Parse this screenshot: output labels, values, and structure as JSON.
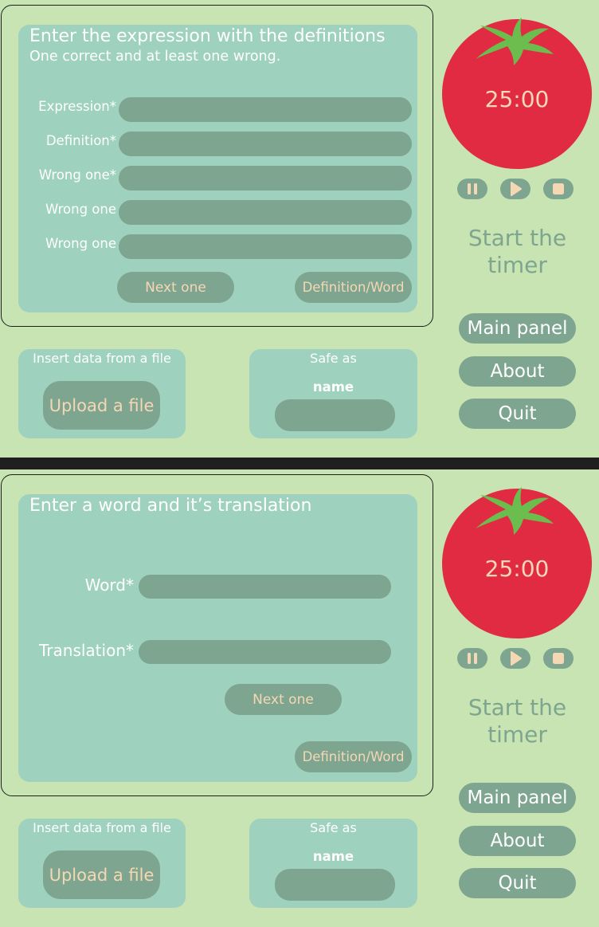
{
  "screens": [
    {
      "title": "Enter the expression with the definitions",
      "subtitle": "One correct and at least one wrong.",
      "fields": [
        {
          "label": "Expression*",
          "value": ""
        },
        {
          "label": "Definition*",
          "value": ""
        },
        {
          "label": "Wrong one*",
          "value": ""
        },
        {
          "label": "Wrong one",
          "value": ""
        },
        {
          "label": "Wrong one",
          "value": ""
        }
      ],
      "next_label": "Next one",
      "toggle_label": "Definition/Word",
      "upload_caption": "Insert data from a file",
      "upload_label": "Upload a file",
      "save_caption": "Safe as",
      "save_name_label": "name",
      "save_name_value": "",
      "timer": "25:00",
      "start_text": "Start the timer",
      "nav": {
        "main": "Main panel",
        "about": "About",
        "quit": "Quit"
      }
    },
    {
      "title": "Enter a word and it’s translation",
      "fields": [
        {
          "label": "Word*",
          "value": ""
        },
        {
          "label": "Translation*",
          "value": ""
        }
      ],
      "next_label": "Next one",
      "toggle_label": "Definition/Word",
      "upload_caption": "Insert data from a file",
      "upload_label": "Upload a file",
      "save_caption": "Safe as",
      "save_name_label": "name",
      "save_name_value": "",
      "timer": "25:00",
      "start_text": "Start the timer",
      "nav": {
        "main": "Main panel",
        "about": "About",
        "quit": "Quit"
      }
    }
  ],
  "colors": {
    "background": "#c8e4b3",
    "panel": "#9ed1be",
    "input": "#7ea58f",
    "accent_text": "#f6d7b4",
    "tomato": "#e02b43",
    "leaf": "#6bbd4e",
    "divider": "#1e1f1e"
  },
  "icons": [
    "tomato-icon",
    "pause-icon",
    "play-icon",
    "stop-icon"
  ]
}
